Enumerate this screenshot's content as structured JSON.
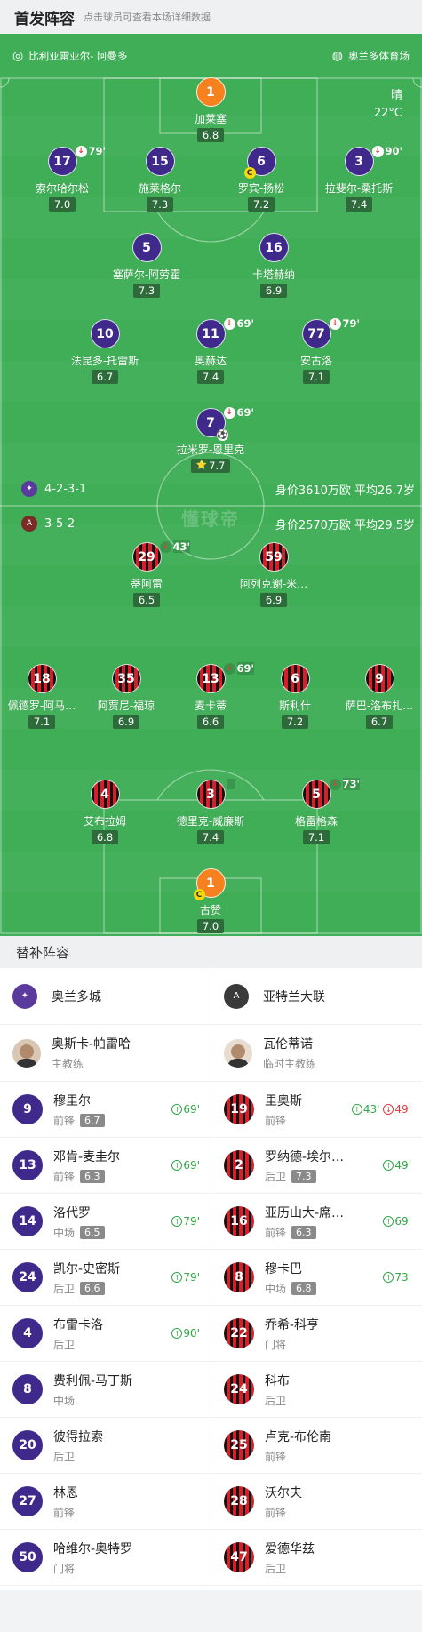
{
  "header": {
    "title": "首发阵容",
    "subtitle": "点击球员可查看本场详细数据"
  },
  "match": {
    "referee": "比利亚雷亚尔- 阿曼多",
    "venue": "奥兰多体育场",
    "weather": "晴",
    "temperature": "22°C",
    "watermark": "懂球帝"
  },
  "home": {
    "formation": "4-2-3-1",
    "value_text": "身价3610万欧 平均26.7岁",
    "players": [
      {
        "num": "1",
        "name": "加莱塞",
        "rating": "6.8",
        "color": "orange"
      },
      {
        "num": "17",
        "name": "索尔哈尔松",
        "rating": "7.0",
        "color": "purple",
        "sub": "79'"
      },
      {
        "num": "15",
        "name": "施莱格尔",
        "rating": "7.3",
        "color": "purple"
      },
      {
        "num": "6",
        "name": "罗宾-扬松",
        "rating": "7.2",
        "color": "purple",
        "captain": "C"
      },
      {
        "num": "3",
        "name": "拉斐尔-桑托斯",
        "rating": "7.4",
        "color": "purple",
        "sub": "90'"
      },
      {
        "num": "5",
        "name": "塞萨尔-阿劳霍",
        "rating": "7.3",
        "color": "purple"
      },
      {
        "num": "16",
        "name": "卡塔赫纳",
        "rating": "6.9",
        "color": "purple"
      },
      {
        "num": "10",
        "name": "法昆多-托雷斯",
        "rating": "6.7",
        "color": "purple"
      },
      {
        "num": "11",
        "name": "奥赫达",
        "rating": "7.4",
        "color": "purple",
        "sub": "69'"
      },
      {
        "num": "77",
        "name": "安古洛",
        "rating": "7.1",
        "color": "purple",
        "sub": "79'"
      },
      {
        "num": "7",
        "name": "拉米罗-恩里克",
        "rating": "7.7",
        "color": "purple",
        "sub": "69'",
        "goal": "⚽",
        "star": "⭐"
      }
    ]
  },
  "away": {
    "formation": "3-5-2",
    "value_text": "身价2570万欧 平均29.5岁",
    "players": [
      {
        "num": "29",
        "name": "蒂阿雷",
        "rating": "6.5",
        "color": "red",
        "sub": "43'"
      },
      {
        "num": "59",
        "name": "阿列克谢-米…",
        "rating": "6.9",
        "color": "red"
      },
      {
        "num": "18",
        "name": "佩德罗-阿马…",
        "rating": "7.1",
        "color": "red"
      },
      {
        "num": "35",
        "name": "阿贾尼-福琼",
        "rating": "6.9",
        "color": "red"
      },
      {
        "num": "13",
        "name": "麦卡蒂",
        "rating": "6.6",
        "color": "red",
        "sub": "69'"
      },
      {
        "num": "6",
        "name": "斯利什",
        "rating": "7.2",
        "color": "red"
      },
      {
        "num": "9",
        "name": "萨巴-洛布扎…",
        "rating": "6.7",
        "color": "red"
      },
      {
        "num": "4",
        "name": "艾布拉姆",
        "rating": "6.8",
        "color": "red"
      },
      {
        "num": "3",
        "name": "德里克-威廉斯",
        "rating": "7.4",
        "color": "red",
        "yellow": true
      },
      {
        "num": "5",
        "name": "格雷格森",
        "rating": "7.1",
        "color": "red",
        "sub": "73'"
      },
      {
        "num": "1",
        "name": "古赞",
        "rating": "7.0",
        "color": "orange",
        "captain": "C"
      }
    ]
  },
  "bench": {
    "title": "替补阵容",
    "home_team": "奥兰多城",
    "away_team": "亚特兰大联",
    "home_coach": {
      "name": "奥斯卡-帕雷哈",
      "role": "主教练"
    },
    "away_coach": {
      "name": "瓦伦蒂诺",
      "role": "临时主教练"
    },
    "home_subs": [
      {
        "num": "9",
        "name": "穆里尔",
        "pos": "前锋",
        "rating": "6.7",
        "in": "69'"
      },
      {
        "num": "13",
        "name": "邓肯-麦圭尔",
        "pos": "前锋",
        "rating": "6.3",
        "in": "69'"
      },
      {
        "num": "14",
        "name": "洛代罗",
        "pos": "中场",
        "rating": "6.5",
        "in": "79'"
      },
      {
        "num": "24",
        "name": "凯尔-史密斯",
        "pos": "后卫",
        "rating": "6.6",
        "in": "79'"
      },
      {
        "num": "4",
        "name": "布雷卡洛",
        "pos": "后卫",
        "in": "90'"
      },
      {
        "num": "8",
        "name": "费利佩-马丁斯",
        "pos": "中场"
      },
      {
        "num": "20",
        "name": "彼得拉索",
        "pos": "后卫"
      },
      {
        "num": "27",
        "name": "林恩",
        "pos": "前锋"
      },
      {
        "num": "50",
        "name": "哈维尔-奥特罗",
        "pos": "门将"
      }
    ],
    "away_subs": [
      {
        "num": "19",
        "name": "里奥斯",
        "pos": "前锋",
        "in": "43'",
        "out": "49'"
      },
      {
        "num": "2",
        "name": "罗纳德-埃尔…",
        "pos": "后卫",
        "rating": "7.3",
        "in": "49'"
      },
      {
        "num": "16",
        "name": "亚历山大-席…",
        "pos": "前锋",
        "rating": "6.3",
        "in": "69'"
      },
      {
        "num": "8",
        "name": "穆卡巴",
        "pos": "中场",
        "rating": "6.8",
        "in": "73'"
      },
      {
        "num": "22",
        "name": "乔希-科亨",
        "pos": "门将"
      },
      {
        "num": "24",
        "name": "科布",
        "pos": "后卫"
      },
      {
        "num": "25",
        "name": "卢克-布伦南",
        "pos": "前锋"
      },
      {
        "num": "28",
        "name": "沃尔夫",
        "pos": "前锋"
      },
      {
        "num": "47",
        "name": "爱德华兹",
        "pos": "后卫"
      }
    ]
  }
}
